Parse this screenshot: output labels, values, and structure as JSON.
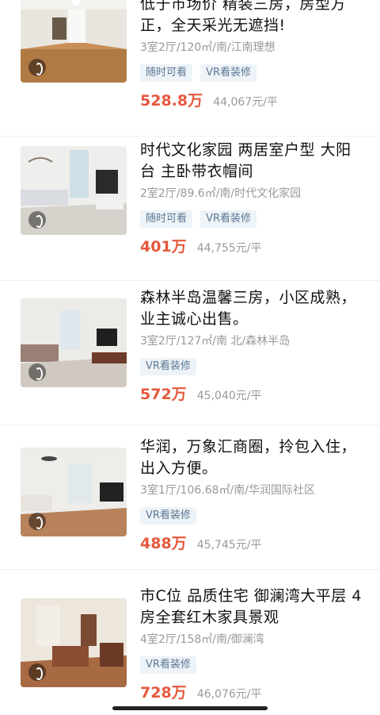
{
  "listings": [
    {
      "title": "低于市场价 精装三房，房型方正，全天采光无遮挡!",
      "meta": "3室2厅/120㎡/南/江南理想",
      "tags": [
        "随时可看",
        "VR看装修"
      ],
      "price": "528.8万",
      "unit_price": "44,067元/平"
    },
    {
      "title": "时代文化家园 两居室户型 大阳台 主卧带衣帽间",
      "meta": "2室2厅/89.6㎡/南/时代文化家园",
      "tags": [
        "随时可看",
        "VR看装修"
      ],
      "price": "401万",
      "unit_price": "44,755元/平"
    },
    {
      "title": "森林半岛温馨三房，小区成熟，业主诚心出售。",
      "meta": "3室2厅/127㎡/南 北/森林半岛",
      "tags": [
        "VR看装修"
      ],
      "price": "572万",
      "unit_price": "45,040元/平"
    },
    {
      "title": "华润，万象汇商圈，拎包入住，出入方便。",
      "meta": "3室1厅/106.68㎡/南/华润国际社区",
      "tags": [
        "VR看装修"
      ],
      "price": "488万",
      "unit_price": "45,745元/平"
    },
    {
      "title": "市C位 品质住宅 御澜湾大平层 4房全套红木家具景观",
      "meta": "4室2厅/158㎡/南/御澜湾",
      "tags": [
        "VR看装修"
      ],
      "price": "728万",
      "unit_price": "46,076元/平"
    }
  ],
  "colors": {
    "price": "#e5583c",
    "tag_bg": "#eef3f7",
    "tag_text": "#5c7896"
  },
  "icons": [
    "vr-360-icon"
  ]
}
